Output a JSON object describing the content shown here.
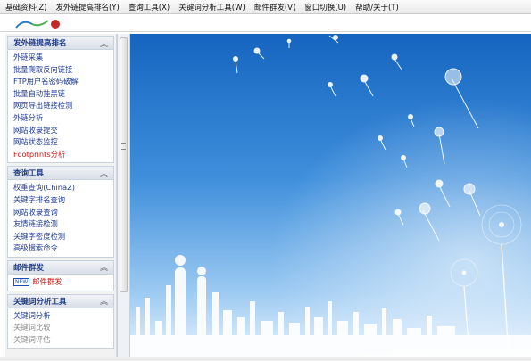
{
  "menu": [
    "基础资料(Z)",
    "发外链提高排名(Y)",
    "查询工具(X)",
    "关键词分析工具(W)",
    "邮件群发(V)",
    "窗口切换(U)",
    "帮助/关于(T)"
  ],
  "sidebar": {
    "panels": [
      {
        "title": "发外链提高排名",
        "items": [
          {
            "label": "外链采集"
          },
          {
            "label": "批量爬取反向链接"
          },
          {
            "label": "FTP用户名密码破解"
          },
          {
            "label": "批量自动挂黑链"
          },
          {
            "label": "网页导出链接检测"
          },
          {
            "label": "外链分析"
          },
          {
            "label": "网站收录提交"
          },
          {
            "label": "网站状态监控"
          },
          {
            "label": "Footprints分析",
            "color": "red"
          }
        ]
      },
      {
        "title": "查询工具",
        "items": [
          {
            "label": "权重查询(ChinaZ)"
          },
          {
            "label": "关键字排名查询"
          },
          {
            "label": "网站收录查询"
          },
          {
            "label": "友情链接检测"
          },
          {
            "label": "关键字密度检测"
          },
          {
            "label": "高级搜索命令"
          }
        ]
      },
      {
        "title": "邮件群发",
        "items": [
          {
            "label": "邮件群发",
            "color": "red",
            "badge": "NEW"
          }
        ]
      },
      {
        "title": "关键词分析工具",
        "items": [
          {
            "label": "关键词分析"
          },
          {
            "label": "关键词比较",
            "color": "gray"
          },
          {
            "label": "关键词评估",
            "color": "gray"
          }
        ]
      }
    ]
  },
  "icons": {
    "collapse": "double-chevron-up-icon",
    "logo": "app-logo-icon"
  },
  "colors": {
    "link": "#1f3a93",
    "accent_red": "#d41414",
    "sky_top": "#1565c0",
    "sky_bottom": "#d9ecfb"
  }
}
